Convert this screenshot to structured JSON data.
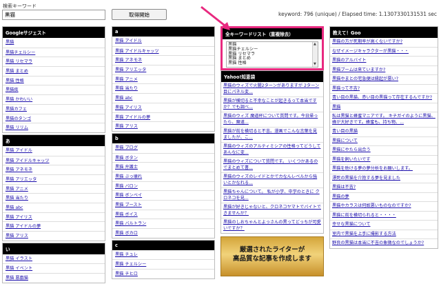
{
  "search": {
    "label": "検索キーワード",
    "value": "黒猫",
    "button": "取得開始",
    "stats": "keyword: 796 (unique) / Elapsed time: 1.1307330131531 sec"
  },
  "google": {
    "title": "Googleサジェスト",
    "items": [
      "黒猫",
      "黒猫チェルシー",
      "黒猫 リセマラ",
      "黒猫 まとめ",
      "黒猫 性格",
      "黒猫疾",
      "黒猫 かわいい",
      "黒猫カフェ",
      "黒猫のタンゴ",
      "黒猫 リリム"
    ]
  },
  "g_a": {
    "title": "a",
    "items": [
      "黒猫 アイドル",
      "黒猫 アイドルキャッツ",
      "黒猫 アネモネ",
      "黒猫 アリエッタ",
      "黒猫 アニメ",
      "黒猫 当たり",
      "黒猫 abc",
      "黒猫 アイリス",
      "黒猫 アイドルの夢",
      "黒猫 アリス"
    ]
  },
  "g_a2": {
    "title": "あ",
    "items": [
      "黒猫 アイドル",
      "黒猫 アイドルキャッツ",
      "黒猫 アネモネ",
      "黒猫 アリエッタ",
      "黒猫 アニメ",
      "黒猫 当たり",
      "黒猫 abc",
      "黒猫 アイリス",
      "黒猫 アイドルの夢",
      "黒猫 アリス"
    ]
  },
  "g_i": {
    "title": "い",
    "items": [
      "黒猫 イラスト",
      "黒猫 イベント",
      "黒猫 悪戯猫"
    ]
  },
  "g_b": {
    "title": "b",
    "items": [
      "黒猫 ブログ",
      "黒猫 ボタン",
      "黒猫 弁護士",
      "黒猫 ぶっ壊れ",
      "黒猫 バロン",
      "黒猫 ボンベイ",
      "黒猫 ブースト",
      "黒猫 ボイス",
      "黒猫 バルトラン",
      "黒猫 ボカロ"
    ]
  },
  "g_c": {
    "title": "c",
    "items": [
      "黒猫 チュレ",
      "黒猫 チェルシー",
      "黒猫 チヒロ"
    ]
  },
  "wordlist": {
    "title": "全キーワードリスト（重複除去）",
    "items": [
      "黒猫",
      "黒猫チェルシー",
      "黒猫 リセマラ",
      "黒猫 まとめ",
      "黒猫 性格"
    ]
  },
  "chiebukuro": {
    "title": "Yahoo!知恵袋",
    "items": [
      "黒猫のウィズで火闇2ターンがありますが 2ターン目にパネル変...",
      "黒猫が横切ると不幸なことが起きるって本当ですか？でも調べ...",
      "黒猫のウィズ 魔道杯について質問です。今日帰ったら、魔道...",
      "黒猫が前を横切ると不吉。漫画でこんな言葉を見ましたが、こ...",
      "黒猫のウィズのアルティミシアの性格ってどうしてあんなに変...",
      "黒猫のウィズについて質問です。 いくつかあるのでまとめて書...",
      "黒猫のウィズのレイドとかでカなんレベルから強いとかなれる...",
      "黒猫ちゃんについて。 私が小学、中学のときに クロネコを見...",
      "黒猫が好きじゃないと、クロネコヤマトでバイトできませんか？",
      "黒猫のしおちゃんとよっさんの黒ってどっちが可愛いですか？"
    ]
  },
  "ad": {
    "line1": "厳選されたライターが",
    "line2": "高品質な記事を作成します"
  },
  "oshiete": {
    "title": "教えて！Goo",
    "items": [
      "黒猫の方が死期率が高くないですか?",
      "なぜイメージキャラクターが黒猫・・・",
      "黒猫のアルバイト",
      "黒猫ブームは来ていますか?",
      "黒猫やまとの宅急便は縁起が悪い?",
      "黒猫って不吉?",
      "青い目の黒猫、赤い目の黒猫って存在するんですか?",
      "黒猫",
      "私は黒猫と蜂蜜マニアです。 キチガイのように黒猫、蜂が大好きです。蜂蜜も、持ち物、...",
      "青い目の黒猫",
      "黒猫について",
      "黒猫にやたら出合う",
      "黒猫を飼いたいです",
      "黒猫を助ける夢の夢分析をお願いします。",
      "漂死の黒猫を介抱する夢を見ました",
      "黒猫は不吉?",
      "黒猫の夢",
      "黒猫やカラスは何故悪いものなのですか?",
      "黒猫に前を横切られると・・・・",
      "幸せな黒猫について",
      "室内で黒猫を上手に撮影する方法",
      "野良の黒猫は本当に不吉の象徴なのでしょうか?"
    ]
  }
}
